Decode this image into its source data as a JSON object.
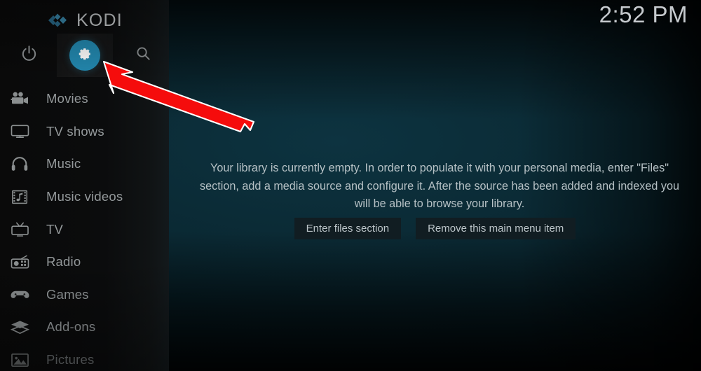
{
  "app": {
    "brand": "KODI",
    "clock": "2:52 PM"
  },
  "toolbar": {
    "power": {
      "label": "Power",
      "icon": "power-icon"
    },
    "settings": {
      "label": "Settings",
      "icon": "gear-icon",
      "selected": true,
      "accent": "#2389b0"
    },
    "search": {
      "label": "Search",
      "icon": "search-icon"
    }
  },
  "sidebar": {
    "items": [
      {
        "label": "Movies",
        "icon": "movie-camera-icon"
      },
      {
        "label": "TV shows",
        "icon": "television-icon"
      },
      {
        "label": "Music",
        "icon": "headphones-icon"
      },
      {
        "label": "Music videos",
        "icon": "film-strip-note-icon"
      },
      {
        "label": "TV",
        "icon": "tv-antenna-icon"
      },
      {
        "label": "Radio",
        "icon": "radio-icon"
      },
      {
        "label": "Games",
        "icon": "gamepad-icon"
      },
      {
        "label": "Add-ons",
        "icon": "addons-box-icon"
      },
      {
        "label": "Pictures",
        "icon": "picture-frame-icon"
      }
    ]
  },
  "main": {
    "empty_message": "Your library is currently empty. In order to populate it with your personal media, enter \"Files\" section, add a media source and configure it. After the source has been added and indexed you will be able to browse your library.",
    "buttons": [
      {
        "label": "Enter files section"
      },
      {
        "label": "Remove this main menu item"
      }
    ]
  },
  "annotation": {
    "arrow": {
      "color": "#f50c0c",
      "outline": "#ffffff",
      "points_to": "settings-gear-button"
    }
  },
  "colors": {
    "accent": "#2389b0",
    "sidebar_bg": "#0b0c0d",
    "content_bg": "#0a2832",
    "text_primary": "#b6c1c5",
    "text_menu": "#94999b",
    "button_bg": "#111d22"
  }
}
